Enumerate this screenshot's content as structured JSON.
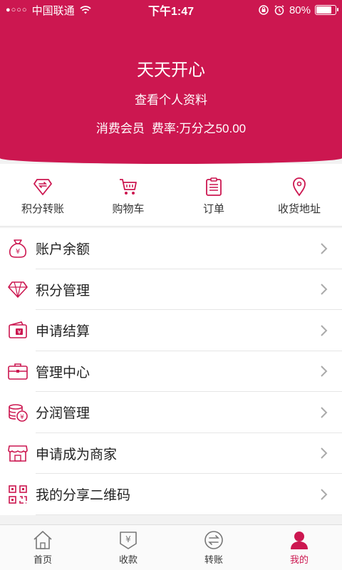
{
  "status_bar": {
    "signal": "●○○○",
    "carrier": "中国联通",
    "time": "下午1:47",
    "battery_text": "80%",
    "battery_level": 0.8
  },
  "header": {
    "username": "天天开心",
    "profile_link": "查看个人资料",
    "member_type": "消费会员",
    "fee_rate": "费率:万分之50.00"
  },
  "quick_actions": [
    {
      "label": "积分转账",
      "icon": "points-transfer-icon"
    },
    {
      "label": "购物车",
      "icon": "cart-icon"
    },
    {
      "label": "订单",
      "icon": "clipboard-icon"
    },
    {
      "label": "收货地址",
      "icon": "location-pin-icon"
    }
  ],
  "menu": [
    {
      "label": "账户余额",
      "icon": "money-bag-icon"
    },
    {
      "label": "积分管理",
      "icon": "diamond-icon"
    },
    {
      "label": "申请结算",
      "icon": "wallet-icon"
    },
    {
      "label": "管理中心",
      "icon": "briefcase-icon"
    },
    {
      "label": "分润管理",
      "icon": "coins-icon"
    },
    {
      "label": "申请成为商家",
      "icon": "store-icon"
    },
    {
      "label": "我的分享二维码",
      "icon": "qr-code-icon"
    }
  ],
  "bottom_nav": [
    {
      "label": "首页",
      "icon": "home-icon",
      "active": false
    },
    {
      "label": "收款",
      "icon": "receive-payment-icon",
      "active": false
    },
    {
      "label": "转账",
      "icon": "transfer-icon",
      "active": false
    },
    {
      "label": "我的",
      "icon": "profile-icon",
      "active": true
    }
  ],
  "colors": {
    "accent": "#cc1750",
    "background": "#f2f2f2",
    "nav_inactive": "#777777"
  }
}
